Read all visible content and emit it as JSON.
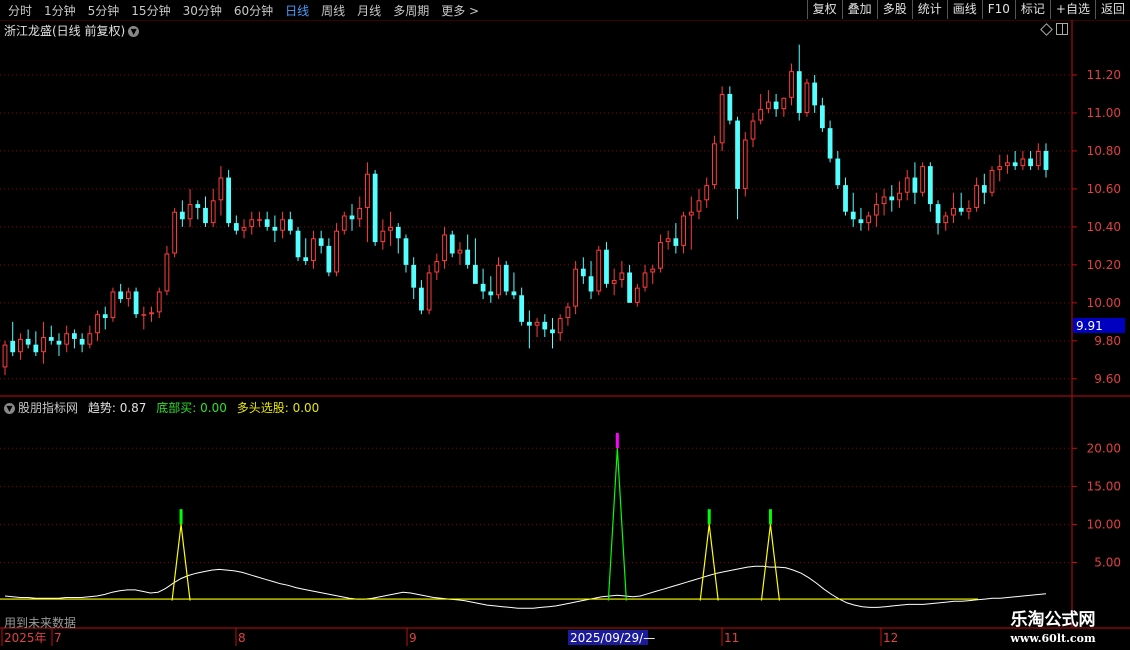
{
  "toolbar": {
    "periods": [
      "分时",
      "1分钟",
      "5分钟",
      "15分钟",
      "30分钟",
      "60分钟",
      "日线",
      "周线",
      "月线",
      "多周期",
      "更多 >"
    ],
    "active_period": "日线",
    "actions": [
      "复权",
      "叠加",
      "多股",
      "统计",
      "画线",
      "F10",
      "标记",
      "+自选",
      "返回"
    ]
  },
  "stock": {
    "title": "浙江龙盛(日线 前复权)",
    "dropdown_icon": "chevron-down-icon"
  },
  "indicator": {
    "name": "股朋指标网",
    "trend_label": "趋势:",
    "trend_value": "0.87",
    "bottom_buy_label": "底部买:",
    "bottom_buy_value": "0.00",
    "bull_label": "多头选股:",
    "bull_value": "0.00"
  },
  "footer": {
    "future_text": "用到未来数据"
  },
  "watermark": {
    "line1": "乐淘公式网",
    "line2": "www.60lt.com"
  },
  "colors": {
    "up": "#ff3c3c",
    "down": "#54ffff",
    "grid": "#8b0000",
    "axis": "#c01010",
    "trend_line": "#ffffff",
    "yellow": "#ffff00",
    "green": "#00ff00",
    "magenta": "#ff00ff",
    "price_tag_bg": "#0000c0"
  },
  "chart_data": [
    {
      "type": "candlestick",
      "title": "浙江龙盛(日线 前复权)",
      "y_ticks": [
        "11.20",
        "11.00",
        "10.80",
        "10.60",
        "10.40",
        "10.20",
        "10.00",
        "9.80",
        "9.60"
      ],
      "ylim": [
        9.52,
        11.4
      ],
      "current_price_label": "9.91",
      "x_axis_labels": [
        "2025年",
        "7",
        "8",
        "9",
        "2025/09/29/—",
        "11",
        "12"
      ],
      "ohlc": [
        [
          9.66,
          9.8,
          9.62,
          9.78
        ],
        [
          9.8,
          9.9,
          9.72,
          9.74
        ],
        [
          9.74,
          9.84,
          9.7,
          9.81
        ],
        [
          9.81,
          9.86,
          9.76,
          9.78
        ],
        [
          9.78,
          9.85,
          9.72,
          9.74
        ],
        [
          9.74,
          9.9,
          9.68,
          9.82
        ],
        [
          9.82,
          9.88,
          9.78,
          9.8
        ],
        [
          9.8,
          9.84,
          9.72,
          9.78
        ],
        [
          9.78,
          9.88,
          9.74,
          9.84
        ],
        [
          9.84,
          9.86,
          9.76,
          9.81
        ],
        [
          9.81,
          9.84,
          9.74,
          9.78
        ],
        [
          9.78,
          9.88,
          9.76,
          9.84
        ],
        [
          9.84,
          9.96,
          9.8,
          9.94
        ],
        [
          9.94,
          9.98,
          9.86,
          9.92
        ],
        [
          9.92,
          10.08,
          9.9,
          10.06
        ],
        [
          10.06,
          10.1,
          10.0,
          10.02
        ],
        [
          10.02,
          10.08,
          9.98,
          10.06
        ],
        [
          10.06,
          10.08,
          9.92,
          9.94
        ],
        [
          9.94,
          9.98,
          9.86,
          9.94
        ],
        [
          9.94,
          9.98,
          9.9,
          9.95
        ],
        [
          9.95,
          10.08,
          9.92,
          10.06
        ],
        [
          10.06,
          10.3,
          10.04,
          10.26
        ],
        [
          10.26,
          10.5,
          10.24,
          10.48
        ],
        [
          10.48,
          10.54,
          10.4,
          10.44
        ],
        [
          10.44,
          10.6,
          10.4,
          10.52
        ],
        [
          10.52,
          10.54,
          10.44,
          10.5
        ],
        [
          10.5,
          10.56,
          10.4,
          10.42
        ],
        [
          10.42,
          10.6,
          10.4,
          10.54
        ],
        [
          10.54,
          10.72,
          10.46,
          10.66
        ],
        [
          10.66,
          10.7,
          10.4,
          10.42
        ],
        [
          10.42,
          10.46,
          10.36,
          10.38
        ],
        [
          10.38,
          10.44,
          10.34,
          10.4
        ],
        [
          10.4,
          10.48,
          10.36,
          10.44
        ],
        [
          10.44,
          10.48,
          10.4,
          10.44
        ],
        [
          10.44,
          10.48,
          10.38,
          10.4
        ],
        [
          10.4,
          10.46,
          10.32,
          10.38
        ],
        [
          10.38,
          10.48,
          10.34,
          10.44
        ],
        [
          10.44,
          10.48,
          10.36,
          10.38
        ],
        [
          10.38,
          10.4,
          10.22,
          10.24
        ],
        [
          10.24,
          10.34,
          10.2,
          10.22
        ],
        [
          10.22,
          10.38,
          10.18,
          10.34
        ],
        [
          10.34,
          10.38,
          10.26,
          10.3
        ],
        [
          10.3,
          10.34,
          10.14,
          10.16
        ],
        [
          10.16,
          10.42,
          10.14,
          10.38
        ],
        [
          10.38,
          10.48,
          10.36,
          10.46
        ],
        [
          10.46,
          10.52,
          10.38,
          10.44
        ],
        [
          10.44,
          10.56,
          10.4,
          10.5
        ],
        [
          10.5,
          10.74,
          10.32,
          10.68
        ],
        [
          10.68,
          10.7,
          10.3,
          10.32
        ],
        [
          10.32,
          10.44,
          10.28,
          10.38
        ],
        [
          10.38,
          10.48,
          10.3,
          10.4
        ],
        [
          10.4,
          10.42,
          10.26,
          10.34
        ],
        [
          10.34,
          10.36,
          10.16,
          10.2
        ],
        [
          10.2,
          10.24,
          10.02,
          10.08
        ],
        [
          10.08,
          10.12,
          9.94,
          9.96
        ],
        [
          9.96,
          10.2,
          9.94,
          10.16
        ],
        [
          10.16,
          10.26,
          10.12,
          10.22
        ],
        [
          10.22,
          10.4,
          10.18,
          10.36
        ],
        [
          10.36,
          10.38,
          10.24,
          10.26
        ],
        [
          10.26,
          10.32,
          10.2,
          10.28
        ],
        [
          10.28,
          10.36,
          10.18,
          10.2
        ],
        [
          10.2,
          10.34,
          10.14,
          10.1
        ],
        [
          10.1,
          10.18,
          10.02,
          10.06
        ],
        [
          10.06,
          10.14,
          10.0,
          10.04
        ],
        [
          10.04,
          10.24,
          10.02,
          10.2
        ],
        [
          10.2,
          10.22,
          10.04,
          10.06
        ],
        [
          10.06,
          10.16,
          10.02,
          10.04
        ],
        [
          10.04,
          10.08,
          9.88,
          9.9
        ],
        [
          9.9,
          9.96,
          9.76,
          9.88
        ],
        [
          9.88,
          9.92,
          9.82,
          9.9
        ],
        [
          9.9,
          9.94,
          9.82,
          9.86
        ],
        [
          9.86,
          9.92,
          9.76,
          9.84
        ],
        [
          9.84,
          9.94,
          9.8,
          9.92
        ],
        [
          9.92,
          10.0,
          9.88,
          9.98
        ],
        [
          9.98,
          10.22,
          9.94,
          10.18
        ],
        [
          10.18,
          10.24,
          10.1,
          10.14
        ],
        [
          10.14,
          10.22,
          10.02,
          10.06
        ],
        [
          10.06,
          10.3,
          10.04,
          10.28
        ],
        [
          10.28,
          10.32,
          10.08,
          10.1
        ],
        [
          10.1,
          10.18,
          10.04,
          10.12
        ],
        [
          10.12,
          10.22,
          10.08,
          10.16
        ],
        [
          10.16,
          10.2,
          10.02,
          10.0
        ],
        [
          10.0,
          10.1,
          9.98,
          10.08
        ],
        [
          10.08,
          10.2,
          10.06,
          10.16
        ],
        [
          10.16,
          10.2,
          10.1,
          10.18
        ],
        [
          10.18,
          10.36,
          10.16,
          10.32
        ],
        [
          10.32,
          10.38,
          10.28,
          10.34
        ],
        [
          10.34,
          10.42,
          10.26,
          10.3
        ],
        [
          10.3,
          10.48,
          10.26,
          10.46
        ],
        [
          10.46,
          10.56,
          10.28,
          10.48
        ],
        [
          10.48,
          10.6,
          10.44,
          10.54
        ],
        [
          10.54,
          10.66,
          10.5,
          10.62
        ],
        [
          10.62,
          10.88,
          10.6,
          10.84
        ],
        [
          10.84,
          11.14,
          10.8,
          11.1
        ],
        [
          11.1,
          11.14,
          10.94,
          10.96
        ],
        [
          10.96,
          10.98,
          10.44,
          10.6
        ],
        [
          10.6,
          10.9,
          10.56,
          10.86
        ],
        [
          10.86,
          11.0,
          10.82,
          10.96
        ],
        [
          10.96,
          11.1,
          10.94,
          11.02
        ],
        [
          11.02,
          11.12,
          11.0,
          11.06
        ],
        [
          11.06,
          11.1,
          10.98,
          11.02
        ],
        [
          11.02,
          11.08,
          10.98,
          11.08
        ],
        [
          11.08,
          11.26,
          11.04,
          11.22
        ],
        [
          11.22,
          11.36,
          10.96,
          11.0
        ],
        [
          11.0,
          11.18,
          10.98,
          11.16
        ],
        [
          11.16,
          11.2,
          11.0,
          11.04
        ],
        [
          11.04,
          11.08,
          10.9,
          10.92
        ],
        [
          10.92,
          10.96,
          10.74,
          10.76
        ],
        [
          10.76,
          10.8,
          10.6,
          10.62
        ],
        [
          10.62,
          10.66,
          10.46,
          10.48
        ],
        [
          10.48,
          10.58,
          10.4,
          10.44
        ],
        [
          10.44,
          10.5,
          10.38,
          10.42
        ],
        [
          10.42,
          10.48,
          10.38,
          10.46
        ],
        [
          10.46,
          10.58,
          10.4,
          10.52
        ],
        [
          10.52,
          10.6,
          10.46,
          10.56
        ],
        [
          10.56,
          10.62,
          10.48,
          10.54
        ],
        [
          10.54,
          10.64,
          10.5,
          10.58
        ],
        [
          10.58,
          10.7,
          10.54,
          10.66
        ],
        [
          10.66,
          10.74,
          10.52,
          10.58
        ],
        [
          10.58,
          10.74,
          10.56,
          10.72
        ],
        [
          10.72,
          10.74,
          10.48,
          10.52
        ],
        [
          10.52,
          10.54,
          10.36,
          10.42
        ],
        [
          10.42,
          10.48,
          10.38,
          10.46
        ],
        [
          10.46,
          10.58,
          10.42,
          10.5
        ],
        [
          10.5,
          10.58,
          10.46,
          10.48
        ],
        [
          10.48,
          10.54,
          10.44,
          10.5
        ],
        [
          10.5,
          10.66,
          10.48,
          10.62
        ],
        [
          10.62,
          10.68,
          10.52,
          10.58
        ],
        [
          10.58,
          10.72,
          10.56,
          10.7
        ],
        [
          10.7,
          10.78,
          10.64,
          10.72
        ],
        [
          10.72,
          10.78,
          10.68,
          10.74
        ],
        [
          10.74,
          10.8,
          10.7,
          10.72
        ],
        [
          10.72,
          10.8,
          10.7,
          10.76
        ],
        [
          10.76,
          10.8,
          10.7,
          10.72
        ],
        [
          10.72,
          10.84,
          10.7,
          10.8
        ],
        [
          10.8,
          10.84,
          10.66,
          10.7
        ]
      ]
    },
    {
      "type": "line",
      "title": "股朋指标网",
      "y_ticks": [
        "20.00",
        "15.00",
        "10.00",
        "5.00"
      ],
      "ylim": [
        -1.5,
        24.5
      ],
      "series": [
        {
          "name": "趋势",
          "values": [
            0.6,
            0.5,
            0.4,
            0.4,
            0.3,
            0.3,
            0.3,
            0.3,
            0.4,
            0.4,
            0.4,
            0.5,
            0.6,
            0.8,
            1.1,
            1.3,
            1.4,
            1.4,
            1.2,
            1.0,
            1.1,
            1.6,
            2.3,
            2.9,
            3.3,
            3.6,
            3.8,
            4.0,
            4.1,
            4.0,
            3.9,
            3.7,
            3.4,
            3.1,
            2.8,
            2.5,
            2.2,
            2.0,
            1.7,
            1.5,
            1.3,
            1.1,
            0.9,
            0.7,
            0.5,
            0.3,
            0.2,
            0.2,
            0.3,
            0.5,
            0.7,
            0.9,
            1.1,
            1.0,
            0.8,
            0.6,
            0.4,
            0.3,
            0.2,
            0.1,
            0.0,
            -0.2,
            -0.4,
            -0.6,
            -0.7,
            -0.8,
            -0.9,
            -1.0,
            -1.0,
            -1.0,
            -0.9,
            -0.8,
            -0.7,
            -0.5,
            -0.3,
            -0.1,
            0.1,
            0.3,
            0.5,
            0.6,
            0.7,
            0.6,
            0.5,
            0.6,
            0.9,
            1.2,
            1.5,
            1.8,
            2.1,
            2.4,
            2.7,
            3.0,
            3.3,
            3.6,
            3.8,
            4.0,
            4.2,
            4.4,
            4.5,
            4.5,
            4.4,
            4.4,
            4.3,
            4.0,
            3.6,
            3.0,
            2.3,
            1.5,
            0.8,
            0.2,
            -0.3,
            -0.6,
            -0.8,
            -0.9,
            -0.9,
            -0.8,
            -0.7,
            -0.6,
            -0.5,
            -0.5,
            -0.5,
            -0.4,
            -0.3,
            -0.2,
            -0.1,
            -0.1,
            0.0,
            0.1,
            0.2,
            0.3,
            0.3,
            0.4,
            0.5,
            0.6,
            0.7,
            0.8,
            0.9
          ]
        },
        {
          "name": "底部买",
          "values": [
            0.0
          ]
        },
        {
          "name": "多头选股",
          "values": [
            0.0
          ]
        }
      ],
      "signal_spikes": [
        {
          "index": 23,
          "value": 10.0,
          "cap": 12.0,
          "cap_color": "green"
        },
        {
          "index": 80,
          "value": 20.0,
          "cap": 22.0,
          "cap_color": "magenta"
        },
        {
          "index": 92,
          "value": 10.0,
          "cap": 12.0,
          "cap_color": "green"
        },
        {
          "index": 100,
          "value": 10.0,
          "cap": 12.0,
          "cap_color": "green"
        }
      ]
    }
  ]
}
